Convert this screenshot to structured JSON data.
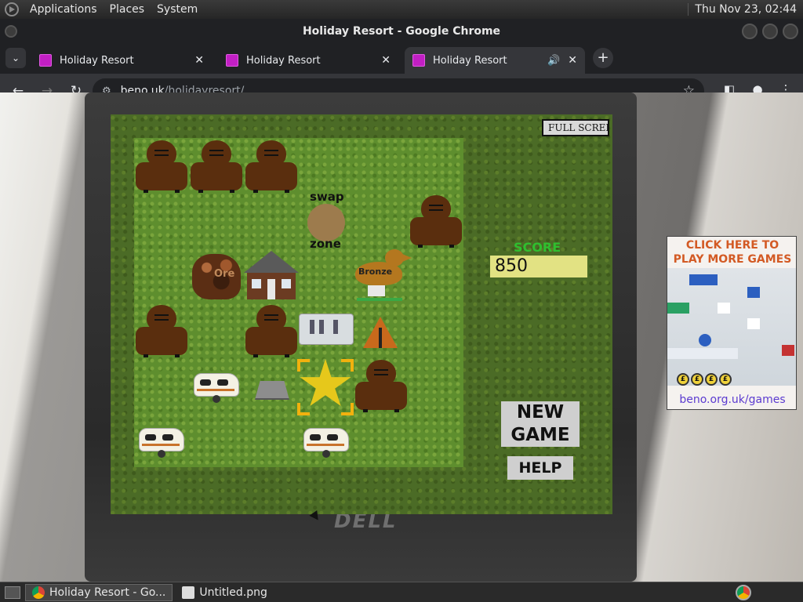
{
  "panel": {
    "menus": [
      "Applications",
      "Places",
      "System"
    ],
    "clock": "Thu Nov 23, 02:44"
  },
  "window": {
    "title": "Holiday Resort - Google Chrome"
  },
  "tabs": [
    {
      "title": "Holiday Resort",
      "active": false
    },
    {
      "title": "Holiday Resort",
      "active": false
    },
    {
      "title": "Holiday Resort",
      "active": true,
      "audio": true
    }
  ],
  "omnibox": {
    "host": "beno.uk",
    "path": "/holidayresort/"
  },
  "game": {
    "full_screen_label": "FULL SCREEN",
    "score_label": "SCORE",
    "score": "850",
    "swap_top": "swap",
    "swap_bottom": "zone",
    "bronze_label": "Bronze",
    "ore_label": "Ore",
    "new_game_line1": "NEW",
    "new_game_line2": "GAME",
    "help_label": "HELP",
    "colors": {
      "score_label": "#2fbf2f",
      "score_bg": "#e2e283",
      "cursor": "#f2b10e"
    }
  },
  "ad": {
    "title_line1": "CLICK HERE TO",
    "title_line2": "PLAY MORE GAMES",
    "link": "beno.org.uk/games"
  },
  "taskbar": {
    "items": [
      {
        "label": "Holiday Resort - Go...",
        "active": true
      },
      {
        "label": "Untitled.png",
        "active": false
      }
    ]
  }
}
